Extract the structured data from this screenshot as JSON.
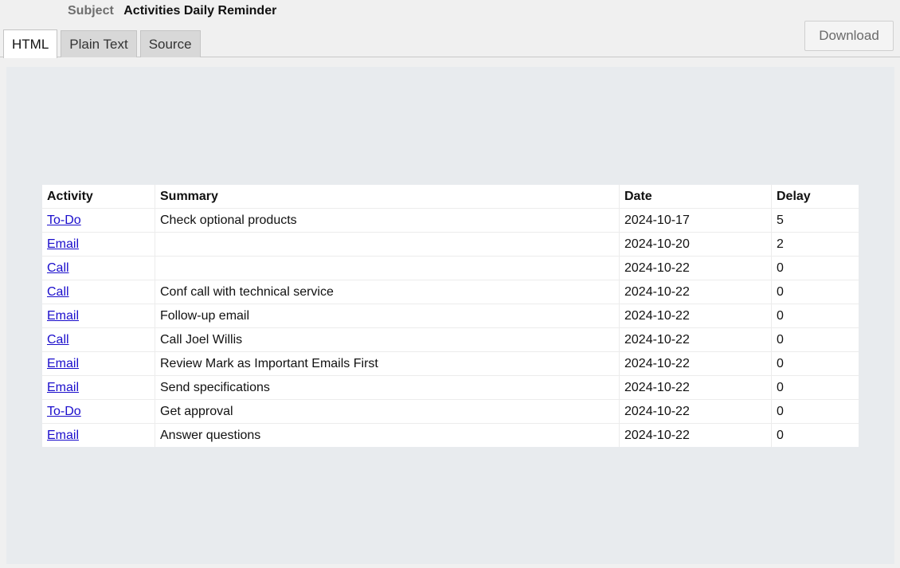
{
  "header": {
    "subject_label": "Subject",
    "subject_value": "Activities Daily Reminder",
    "tabs": [
      {
        "label": "HTML",
        "active": true
      },
      {
        "label": "Plain Text",
        "active": false
      },
      {
        "label": "Source",
        "active": false
      }
    ],
    "download_label": "Download"
  },
  "table": {
    "columns": [
      "Activity",
      "Summary",
      "Date",
      "Delay"
    ],
    "rows": [
      {
        "activity": "To-Do",
        "summary": "Check optional products",
        "date": "2024-10-17",
        "delay": "5"
      },
      {
        "activity": "Email",
        "summary": "",
        "date": "2024-10-20",
        "delay": "2"
      },
      {
        "activity": "Call",
        "summary": "",
        "date": "2024-10-22",
        "delay": "0"
      },
      {
        "activity": "Call",
        "summary": "Conf call with technical service",
        "date": "2024-10-22",
        "delay": "0"
      },
      {
        "activity": "Email",
        "summary": "Follow-up email",
        "date": "2024-10-22",
        "delay": "0"
      },
      {
        "activity": "Call",
        "summary": "Call Joel Willis",
        "date": "2024-10-22",
        "delay": "0"
      },
      {
        "activity": "Email",
        "summary": "Review Mark as Important Emails First",
        "date": "2024-10-22",
        "delay": "0"
      },
      {
        "activity": "Email",
        "summary": "Send specifications",
        "date": "2024-10-22",
        "delay": "0"
      },
      {
        "activity": "To-Do",
        "summary": "Get approval",
        "date": "2024-10-22",
        "delay": "0"
      },
      {
        "activity": "Email",
        "summary": "Answer questions",
        "date": "2024-10-22",
        "delay": "0"
      }
    ]
  },
  "colors": {
    "link": "#1a0dcc",
    "content_background": "#e8ebee",
    "toolbar_background": "#f0f0f0"
  }
}
